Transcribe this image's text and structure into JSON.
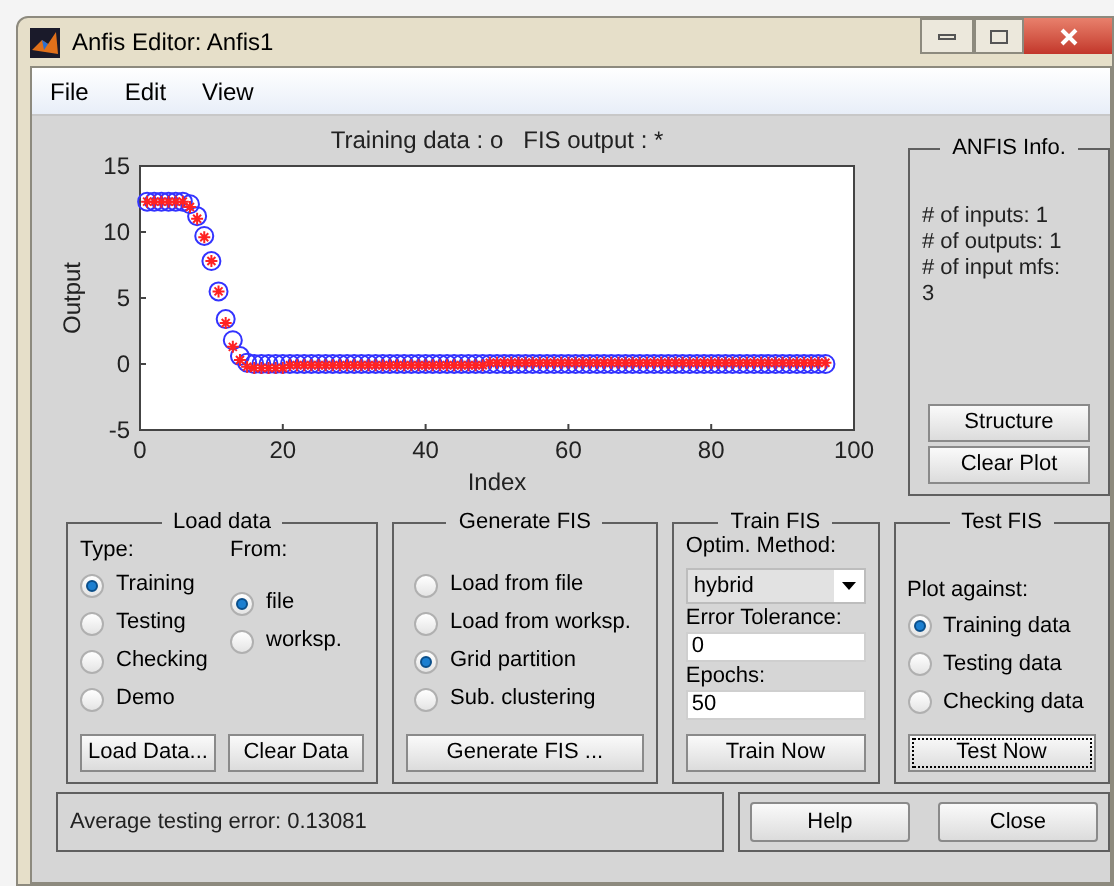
{
  "window": {
    "title": "Anfis Editor: Anfis1"
  },
  "menu": [
    "File",
    "Edit",
    "View"
  ],
  "plot": {
    "chart_data": {
      "type": "scatter",
      "title": "Training data : o   FIS output : *",
      "xlabel": "Index",
      "ylabel": "Output",
      "xlim": [
        0,
        100
      ],
      "ylim": [
        -5,
        15
      ],
      "xticks": [
        0,
        20,
        40,
        60,
        80,
        100
      ],
      "yticks": [
        -5,
        0,
        5,
        10,
        15
      ],
      "x": [
        1,
        2,
        3,
        4,
        5,
        6,
        7,
        8,
        9,
        10,
        11,
        12,
        13,
        14,
        15,
        16,
        17,
        18,
        19,
        20,
        21,
        22,
        23,
        24,
        25,
        26,
        27,
        28,
        29,
        30,
        31,
        32,
        33,
        34,
        35,
        36,
        37,
        38,
        39,
        40,
        41,
        42,
        43,
        44,
        45,
        46,
        47,
        48,
        49,
        50,
        51,
        52,
        53,
        54,
        55,
        56,
        57,
        58,
        59,
        60,
        61,
        62,
        63,
        64,
        65,
        66,
        67,
        68,
        69,
        70,
        71,
        72,
        73,
        74,
        75,
        76,
        77,
        78,
        79,
        80,
        81,
        82,
        83,
        84,
        85,
        86,
        87,
        88,
        89,
        90,
        91,
        92,
        93,
        94,
        95,
        96
      ],
      "series": [
        {
          "color": "#3333ff",
          "values": [
            12.3,
            12.3,
            12.3,
            12.3,
            12.3,
            12.3,
            12.1,
            11.2,
            9.7,
            7.8,
            5.5,
            3.4,
            1.8,
            0.6,
            0.1,
            0,
            0,
            0,
            0,
            0,
            0,
            0,
            0,
            0,
            0,
            0,
            0,
            0,
            0,
            0,
            0,
            0,
            0,
            0,
            0,
            0,
            0,
            0,
            0,
            0,
            0,
            0,
            0,
            0,
            0,
            0,
            0,
            0,
            0,
            0,
            0,
            0,
            0,
            0,
            0,
            0,
            0,
            0,
            0,
            0,
            0,
            0,
            0,
            0,
            0,
            0,
            0,
            0,
            0,
            0,
            0,
            0,
            0,
            0,
            0,
            0,
            0,
            0,
            0,
            0,
            0,
            0,
            0,
            0,
            0,
            0,
            0,
            0,
            0,
            0,
            0,
            0,
            0,
            0,
            0,
            0
          ]
        },
        {
          "color": "#ff2222",
          "values": [
            12.3,
            12.3,
            12.3,
            12.3,
            12.3,
            12.3,
            11.9,
            11.0,
            9.6,
            7.8,
            5.5,
            3.1,
            1.3,
            0.3,
            -0.2,
            -0.3,
            -0.3,
            -0.3,
            -0.3,
            -0.3,
            -0.1,
            -0.1,
            -0.1,
            -0.1,
            -0.1,
            -0.1,
            -0.1,
            -0.1,
            -0.1,
            -0.1,
            -0.1,
            -0.1,
            -0.1,
            -0.1,
            -0.1,
            -0.1,
            -0.1,
            -0.1,
            -0.1,
            -0.1,
            -0.1,
            -0.1,
            -0.1,
            -0.1,
            -0.1,
            -0.1,
            -0.1,
            -0.1,
            0.1,
            0.1,
            0.1,
            0.1,
            0.1,
            0.1,
            0.1,
            0.1,
            0.1,
            0.1,
            0.1,
            0.1,
            0.1,
            0.1,
            0.1,
            0.1,
            0.1,
            0.1,
            0.1,
            0.1,
            0.1,
            0.1,
            0.1,
            0.1,
            0.1,
            0.1,
            0.1,
            0.1,
            0.1,
            0.1,
            0.1,
            0.1,
            0.1,
            0.1,
            0.1,
            0.1,
            0.1,
            0.1,
            0.1,
            0.1,
            0.1,
            0.1,
            0.1,
            0.1,
            0.1,
            0.1,
            0.1,
            0.1
          ]
        }
      ]
    }
  },
  "info": {
    "title": "ANFIS Info.",
    "lines": [
      "# of inputs: 1",
      "# of outputs: 1",
      "# of input mfs:",
      "3"
    ],
    "buttons": [
      "Structure",
      "Clear Plot"
    ]
  },
  "load_data": {
    "title": "Load data",
    "type_label": "Type:",
    "from_label": "From:",
    "type_options": [
      {
        "label": "Training",
        "selected": true
      },
      {
        "label": "Testing",
        "selected": false
      },
      {
        "label": "Checking",
        "selected": false
      },
      {
        "label": "Demo",
        "selected": false
      }
    ],
    "from_options": [
      {
        "label": "file",
        "selected": true
      },
      {
        "label": "worksp.",
        "selected": false
      }
    ],
    "buttons": [
      "Load Data...",
      "Clear Data"
    ]
  },
  "generate_fis": {
    "title": "Generate FIS",
    "options": [
      {
        "label": "Load from file",
        "selected": false
      },
      {
        "label": "Load from worksp.",
        "selected": false
      },
      {
        "label": "Grid partition",
        "selected": true
      },
      {
        "label": "Sub. clustering",
        "selected": false
      }
    ],
    "button": "Generate FIS ..."
  },
  "train_fis": {
    "title": "Train FIS",
    "method_label": "Optim. Method:",
    "method_value": "hybrid",
    "tolerance_label": "Error Tolerance:",
    "tolerance_value": "0",
    "epochs_label": "Epochs:",
    "epochs_value": "50",
    "button": "Train Now"
  },
  "test_fis": {
    "title": "Test FIS",
    "plot_against_label": "Plot against:",
    "options": [
      {
        "label": "Training data",
        "selected": true
      },
      {
        "label": "Testing data",
        "selected": false
      },
      {
        "label": "Checking data",
        "selected": false
      }
    ],
    "button": {
      "label": "Test Now",
      "focused": true
    }
  },
  "status": "Average testing error: 0.13081",
  "dialog_buttons": [
    "Help",
    "Close"
  ]
}
